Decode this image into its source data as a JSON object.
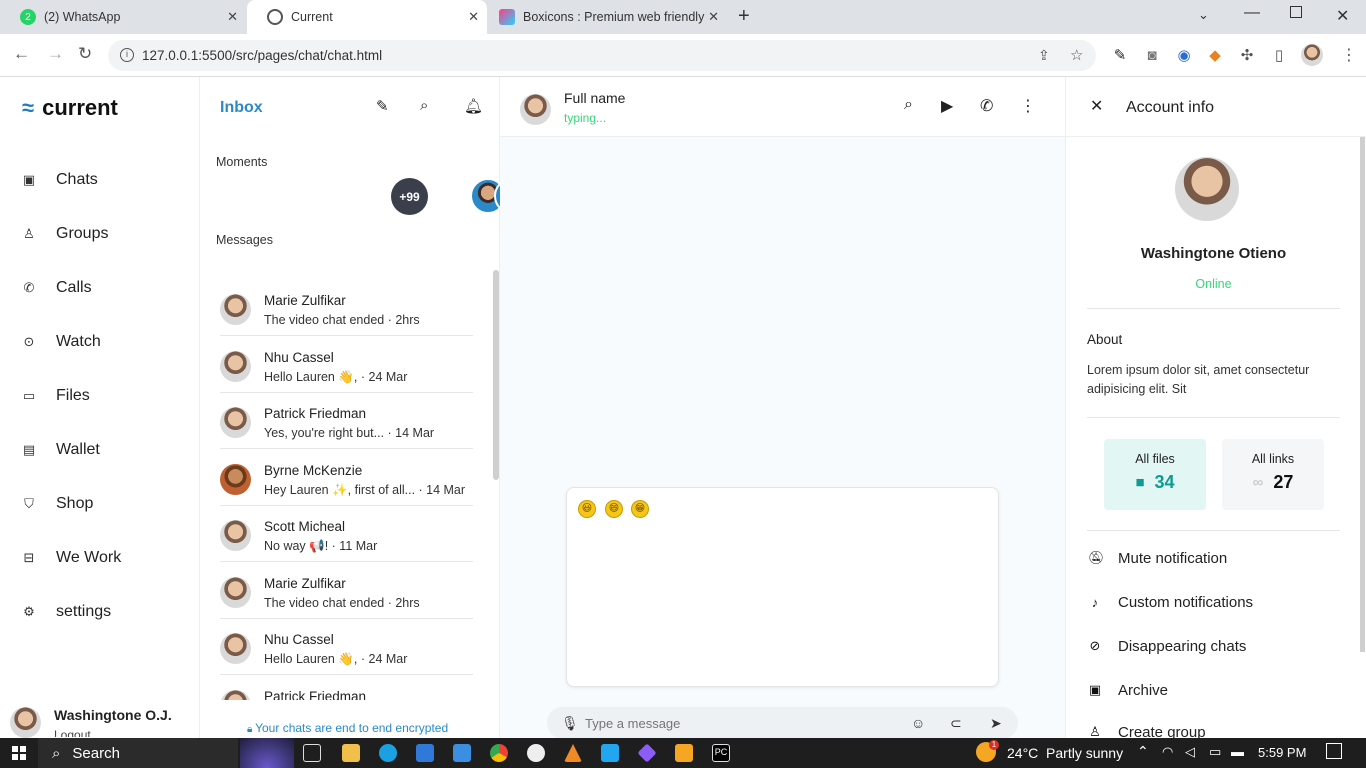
{
  "browser": {
    "tabs": [
      {
        "title": "(2) WhatsApp",
        "favicon": "whatsapp-icon"
      },
      {
        "title": "Current",
        "favicon": "globe-icon"
      },
      {
        "title": "Boxicons : Premium web friendly",
        "favicon": "boxicons-icon"
      }
    ],
    "url": "127.0.0.1:5500/src/pages/chat/chat.html",
    "whatsapp_badge": "2"
  },
  "sidebar": {
    "brand": "current",
    "items": [
      {
        "label": "Chats",
        "icon": "chat-icon"
      },
      {
        "label": "Groups",
        "icon": "group-icon"
      },
      {
        "label": "Calls",
        "icon": "phone-call-icon"
      },
      {
        "label": "Watch",
        "icon": "play-circle-icon"
      },
      {
        "label": "Files",
        "icon": "folder-icon"
      },
      {
        "label": "Wallet",
        "icon": "wallet-icon"
      },
      {
        "label": "Shop",
        "icon": "shopping-bag-icon"
      },
      {
        "label": "We Work",
        "icon": "briefcase-icon"
      },
      {
        "label": "settings",
        "icon": "cog-icon"
      }
    ],
    "user": {
      "name": "Washingtone O.J.",
      "logout": "Logout"
    }
  },
  "inbox": {
    "title": "Inbox",
    "moments_label": "Moments",
    "moments_more": "+99",
    "messages_label": "Messages",
    "messages": [
      {
        "name": "Marie Zulfikar",
        "preview": "The video chat ended · 2hrs"
      },
      {
        "name": "Nhu Cassel",
        "preview": "Hello Lauren 👋, · 24 Mar"
      },
      {
        "name": "Patrick Friedman",
        "preview": "Yes, you're right but... · 14 Mar"
      },
      {
        "name": "Byrne McKenzie",
        "preview": "Hey Lauren ✨, first of all... · 14 Mar"
      },
      {
        "name": "Scott Micheal",
        "preview": "No way 📢! · 11 Mar"
      },
      {
        "name": "Marie Zulfikar",
        "preview": "The video chat ended · 2hrs"
      },
      {
        "name": "Nhu Cassel",
        "preview": "Hello Lauren 👋, · 24 Mar"
      },
      {
        "name": "Patrick Friedman",
        "preview": ""
      }
    ],
    "encrypted_note": "Your chats are end to end encrypted"
  },
  "chat": {
    "name": "Full name",
    "status": "typing...",
    "emojis": [
      "😃",
      "😄",
      "😁"
    ],
    "input_placeholder": "Type a message"
  },
  "account": {
    "title": "Account info",
    "name": "Washingtone Otieno",
    "status": "Online",
    "about_label": "About",
    "about_text": "Lorem ipsum dolor sit, amet consectetur adipisicing elit. Sit",
    "files_label": "All files",
    "files_count": "34",
    "links_label": "All links",
    "links_count": "27",
    "actions": [
      {
        "label": "Mute notification",
        "icon": "bell-off-icon"
      },
      {
        "label": "Custom notifications",
        "icon": "tiktok-icon"
      },
      {
        "label": "Disappearing chats",
        "icon": "eye-off-icon"
      },
      {
        "label": "Archive",
        "icon": "archive-icon"
      },
      {
        "label": "Create group",
        "icon": "user-add-icon"
      }
    ]
  },
  "taskbar": {
    "search": "Search",
    "weather": "24°C  Partly sunny",
    "time": "5:59 PM",
    "weather_badge": "1"
  },
  "colors": {
    "accent": "#2a8ac8",
    "online": "#37d67a",
    "teal": "#0f9a92",
    "card_bg": "#e2f6f3"
  }
}
